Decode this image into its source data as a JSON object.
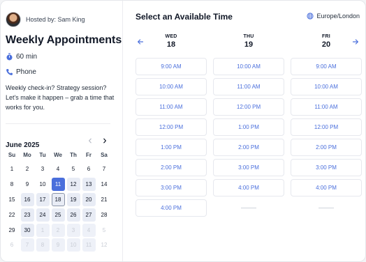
{
  "host": {
    "label": "Hosted by: Sam King"
  },
  "event": {
    "title": "Weekly Appointments",
    "duration": "60 min",
    "location": "Phone",
    "description": "Weekly check-in? Strategy session? Let's make it happen – grab a time that works for you."
  },
  "calendar": {
    "month_label": "June 2025",
    "weekdays": [
      "Su",
      "Mo",
      "Tu",
      "We",
      "Th",
      "Fr",
      "Sa"
    ],
    "days": [
      {
        "label": "1",
        "state": "default"
      },
      {
        "label": "2",
        "state": "default"
      },
      {
        "label": "3",
        "state": "default"
      },
      {
        "label": "4",
        "state": "default"
      },
      {
        "label": "5",
        "state": "default"
      },
      {
        "label": "6",
        "state": "default"
      },
      {
        "label": "7",
        "state": "default"
      },
      {
        "label": "8",
        "state": "default"
      },
      {
        "label": "9",
        "state": "default"
      },
      {
        "label": "10",
        "state": "default"
      },
      {
        "label": "11",
        "state": "selected"
      },
      {
        "label": "12",
        "state": "available"
      },
      {
        "label": "13",
        "state": "available"
      },
      {
        "label": "14",
        "state": "default"
      },
      {
        "label": "15",
        "state": "default"
      },
      {
        "label": "16",
        "state": "available"
      },
      {
        "label": "17",
        "state": "available"
      },
      {
        "label": "18",
        "state": "today"
      },
      {
        "label": "19",
        "state": "available"
      },
      {
        "label": "20",
        "state": "available"
      },
      {
        "label": "21",
        "state": "default"
      },
      {
        "label": "22",
        "state": "default"
      },
      {
        "label": "23",
        "state": "available"
      },
      {
        "label": "24",
        "state": "available"
      },
      {
        "label": "25",
        "state": "available"
      },
      {
        "label": "26",
        "state": "available"
      },
      {
        "label": "27",
        "state": "available"
      },
      {
        "label": "28",
        "state": "default"
      },
      {
        "label": "29",
        "state": "default"
      },
      {
        "label": "30",
        "state": "available"
      },
      {
        "label": "1",
        "state": "next"
      },
      {
        "label": "2",
        "state": "next"
      },
      {
        "label": "3",
        "state": "next"
      },
      {
        "label": "4",
        "state": "next"
      },
      {
        "label": "5",
        "state": "dim"
      },
      {
        "label": "6",
        "state": "dim"
      },
      {
        "label": "7",
        "state": "next"
      },
      {
        "label": "8",
        "state": "next"
      },
      {
        "label": "9",
        "state": "next"
      },
      {
        "label": "10",
        "state": "next"
      },
      {
        "label": "11",
        "state": "next"
      },
      {
        "label": "12",
        "state": "dim"
      }
    ]
  },
  "schedule": {
    "title": "Select an Available Time",
    "timezone": "Europe/London",
    "columns": [
      {
        "dow": "WED",
        "day": "18",
        "slots": [
          "9:00 AM",
          "10:00 AM",
          "11:00 AM",
          "12:00 PM",
          "1:00 PM",
          "2:00 PM",
          "3:00 PM",
          "4:00 PM"
        ]
      },
      {
        "dow": "THU",
        "day": "19",
        "slots": [
          "10:00 AM",
          "11:00 AM",
          "12:00 PM",
          "1:00 PM",
          "2:00 PM",
          "3:00 PM",
          "4:00 PM"
        ]
      },
      {
        "dow": "FRI",
        "day": "20",
        "slots": [
          "9:00 AM",
          "10:00 AM",
          "11:00 AM",
          "12:00 PM",
          "2:00 PM",
          "3:00 PM",
          "4:00 PM"
        ]
      }
    ]
  },
  "colors": {
    "accent": "#4a6fdc",
    "available_bg": "#e8ecf5",
    "border": "#e6e8ee"
  },
  "icons": {
    "timer": "stopwatch-icon",
    "phone": "phone-icon",
    "globe": "globe-icon",
    "prev": "chevron-left-icon",
    "next": "chevron-right-icon"
  }
}
